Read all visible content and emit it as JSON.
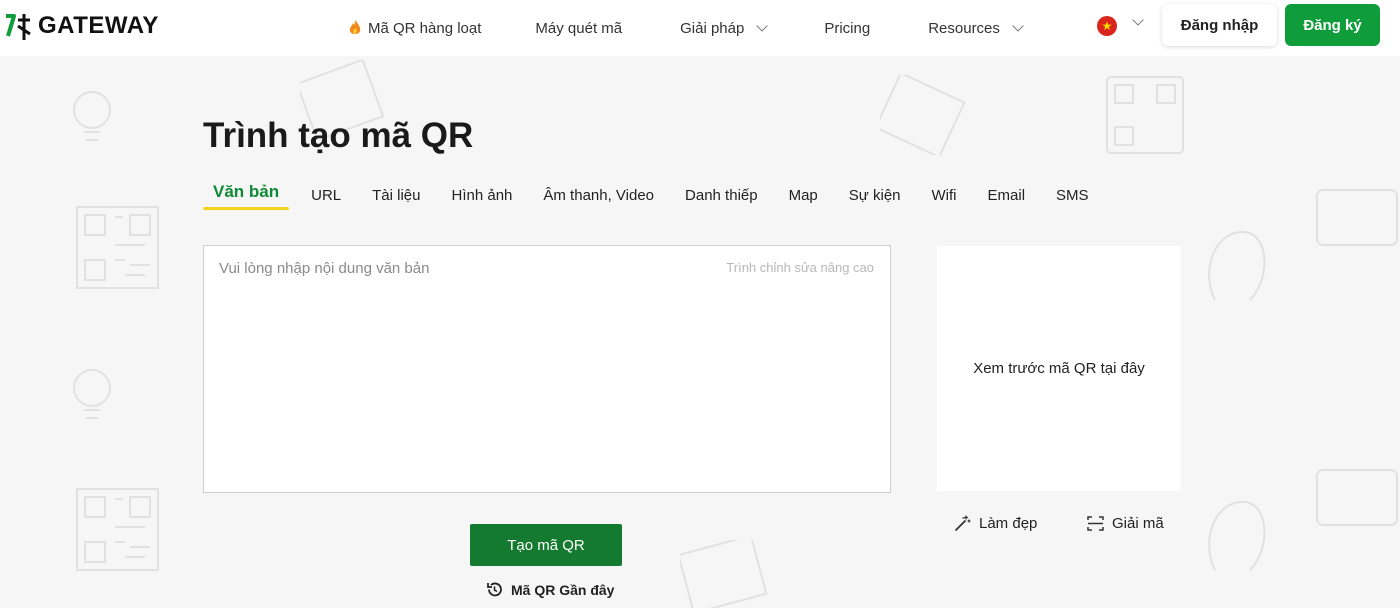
{
  "header": {
    "logo_text": "GATEWAY",
    "nav": [
      {
        "label": "Mã QR hàng loạt",
        "icon": "fire-icon",
        "dropdown": false
      },
      {
        "label": "Máy quét mã",
        "dropdown": false
      },
      {
        "label": "Giải pháp",
        "dropdown": true
      },
      {
        "label": "Pricing",
        "dropdown": false
      },
      {
        "label": "Resources",
        "dropdown": true
      }
    ],
    "language_flag": "vietnam-flag-icon",
    "login_label": "Đăng nhập",
    "signup_label": "Đăng ký"
  },
  "main": {
    "title": "Trình tạo mã QR",
    "tabs": [
      "Văn bản",
      "URL",
      "Tài liệu",
      "Hình ảnh",
      "Âm thanh, Video",
      "Danh thiếp",
      "Map",
      "Sự kiện",
      "Wifi",
      "Email",
      "SMS"
    ],
    "active_tab": "Văn bản",
    "editor": {
      "placeholder": "Vui lòng nhập nội dung văn bản",
      "value": "",
      "advanced_label": "Trình chỉnh sửa nâng cao"
    },
    "preview_text": "Xem trước mã QR tại đây",
    "beautify_label": "Làm đẹp",
    "decode_label": "Giải mã",
    "generate_label": "Tạo mã QR",
    "recent_label": "Mã QR Gần đây"
  },
  "colors": {
    "brand_green": "#0f9d3b",
    "button_green": "#137a2f",
    "accent_yellow": "#f3d21b",
    "background": "#f6f6f6"
  }
}
